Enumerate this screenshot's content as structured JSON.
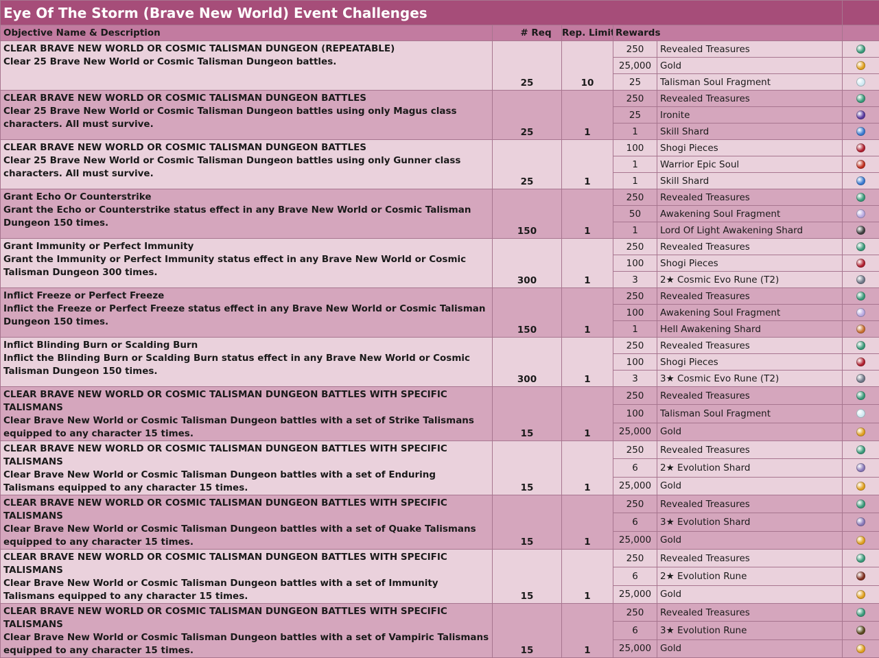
{
  "title": "Eye Of The Storm (Brave New World) Event Challenges",
  "headers": {
    "objective": "Objective Name & Description",
    "req": "# Req",
    "limit": "Rep. Limit",
    "rewards": "Rewards"
  },
  "colors": {
    "title_bg": "#a64d79",
    "header_bg": "#c27ba0",
    "row_light": "#ead1dc",
    "row_dark": "#d5a6bd"
  },
  "challenges": [
    {
      "name": "CLEAR BRAVE NEW WORLD OR COSMIC TALISMAN DUNGEON (REPEATABLE)",
      "desc": "Clear 25 Brave New World or Cosmic Talisman Dungeon battles.",
      "req": "25",
      "limit": "10",
      "rewards": [
        {
          "qty": "250",
          "name": "Revealed Treasures",
          "icon": "revealed-treasures-icon",
          "color": "#3a9a7a"
        },
        {
          "qty": "25,000",
          "name": "Gold",
          "icon": "gold-icon",
          "color": "#e0a020"
        },
        {
          "qty": "25",
          "name": "Talisman Soul Fragment",
          "icon": "talisman-soul-fragment-icon",
          "color": "#cfe8f2"
        }
      ]
    },
    {
      "name": "CLEAR BRAVE NEW WORLD OR COSMIC TALISMAN DUNGEON BATTLES",
      "desc": "Clear 25 Brave New World or Cosmic Talisman Dungeon battles using only Magus class characters. All must survive.",
      "req": "25",
      "limit": "1",
      "rewards": [
        {
          "qty": "250",
          "name": "Revealed Treasures",
          "icon": "revealed-treasures-icon",
          "color": "#3a9a7a"
        },
        {
          "qty": "25",
          "name": "Ironite",
          "icon": "ironite-icon",
          "color": "#5a3aa0"
        },
        {
          "qty": "1",
          "name": "Skill Shard",
          "icon": "skill-shard-icon",
          "color": "#3a7ad0"
        }
      ]
    },
    {
      "name": "CLEAR BRAVE NEW WORLD OR COSMIC TALISMAN DUNGEON BATTLES",
      "desc": "Clear 25 Brave New World or Cosmic Talisman Dungeon battles using only Gunner class characters. All must survive.",
      "req": "25",
      "limit": "1",
      "rewards": [
        {
          "qty": "100",
          "name": "Shogi Pieces",
          "icon": "shogi-pieces-icon",
          "color": "#b02030"
        },
        {
          "qty": "1",
          "name": "Warrior Epic Soul",
          "icon": "warrior-epic-soul-icon",
          "color": "#c03020"
        },
        {
          "qty": "1",
          "name": "Skill Shard",
          "icon": "skill-shard-icon",
          "color": "#3a7ad0"
        }
      ]
    },
    {
      "name": "Grant Echo Or Counterstrike",
      "desc": "Grant the Echo or Counterstrike status effect in any Brave New World or Cosmic Talisman Dungeon 150 times.",
      "req": "150",
      "limit": "1",
      "rewards": [
        {
          "qty": "250",
          "name": "Revealed Treasures",
          "icon": "revealed-treasures-icon",
          "color": "#3a9a7a"
        },
        {
          "qty": "50",
          "name": "Awakening Soul Fragment",
          "icon": "awakening-soul-fragment-icon",
          "color": "#b8a8e0"
        },
        {
          "qty": "1",
          "name": "Lord Of Light Awakening Shard",
          "icon": "lord-of-light-awakening-shard-icon",
          "color": "#404040"
        }
      ]
    },
    {
      "name": "Grant Immunity or Perfect Immunity",
      "desc": "Grant the Immunity or Perfect Immunity status effect in any Brave New World or Cosmic Talisman Dungeon 300 times.",
      "req": "300",
      "limit": "1",
      "rewards": [
        {
          "qty": "250",
          "name": "Revealed Treasures",
          "icon": "revealed-treasures-icon",
          "color": "#3a9a7a"
        },
        {
          "qty": "100",
          "name": "Shogi Pieces",
          "icon": "shogi-pieces-icon",
          "color": "#b02030"
        },
        {
          "qty": "3",
          "name": "2★ Cosmic Evo Rune (T2)",
          "icon": "cosmic-evo-rune-icon",
          "color": "#707888"
        }
      ]
    },
    {
      "name": "Inflict Freeze or Perfect Freeze",
      "desc": "Inflict the Freeze or Perfect Freeze status effect in any Brave New World or Cosmic Talisman Dungeon 150 times.",
      "req": "150",
      "limit": "1",
      "rewards": [
        {
          "qty": "250",
          "name": "Revealed Treasures",
          "icon": "revealed-treasures-icon",
          "color": "#3a9a7a"
        },
        {
          "qty": "100",
          "name": "Awakening Soul Fragment",
          "icon": "awakening-soul-fragment-icon",
          "color": "#b8a8e0"
        },
        {
          "qty": "1",
          "name": "Hell Awakening Shard",
          "icon": "hell-awakening-shard-icon",
          "color": "#c87030"
        }
      ]
    },
    {
      "name": "Inflict Blinding Burn or Scalding Burn",
      "desc": "Inflict the Blinding Burn or Scalding Burn status effect in any Brave New World or Cosmic Talisman Dungeon 150 times.",
      "req": "300",
      "limit": "1",
      "rewards": [
        {
          "qty": "250",
          "name": "Revealed Treasures",
          "icon": "revealed-treasures-icon",
          "color": "#3a9a7a"
        },
        {
          "qty": "100",
          "name": "Shogi Pieces",
          "icon": "shogi-pieces-icon",
          "color": "#b02030"
        },
        {
          "qty": "3",
          "name": "3★ Cosmic Evo Rune (T2)",
          "icon": "cosmic-evo-rune-icon",
          "color": "#707888"
        }
      ]
    },
    {
      "name": "CLEAR BRAVE NEW WORLD OR COSMIC TALISMAN DUNGEON BATTLES WITH SPECIFIC TALISMANS",
      "desc": "Clear Brave New World or Cosmic Talisman Dungeon battles with a set of Strike Talismans equipped to any character 15 times.",
      "req": "15",
      "limit": "1",
      "rewards": [
        {
          "qty": "250",
          "name": "Revealed Treasures",
          "icon": "revealed-treasures-icon",
          "color": "#3a9a7a"
        },
        {
          "qty": "100",
          "name": "Talisman Soul Fragment",
          "icon": "talisman-soul-fragment-icon",
          "color": "#cfe8f2"
        },
        {
          "qty": "25,000",
          "name": "Gold",
          "icon": "gold-icon",
          "color": "#e0a020"
        }
      ]
    },
    {
      "name": "CLEAR BRAVE NEW WORLD OR COSMIC TALISMAN DUNGEON BATTLES WITH SPECIFIC TALISMANS",
      "desc": "Clear Brave New World or Cosmic Talisman Dungeon battles with a set of Enduring Talismans equipped to any character 15 times.",
      "req": "15",
      "limit": "1",
      "rewards": [
        {
          "qty": "250",
          "name": "Revealed Treasures",
          "icon": "revealed-treasures-icon",
          "color": "#3a9a7a"
        },
        {
          "qty": "6",
          "name": "2★ Evolution Shard",
          "icon": "evolution-shard-icon",
          "color": "#8878b8"
        },
        {
          "qty": "25,000",
          "name": "Gold",
          "icon": "gold-icon",
          "color": "#e0a020"
        }
      ]
    },
    {
      "name": "CLEAR BRAVE NEW WORLD OR COSMIC TALISMAN DUNGEON BATTLES WITH SPECIFIC TALISMANS",
      "desc": "Clear Brave New World or Cosmic Talisman Dungeon battles with a set of Quake Talismans equipped to any character 15 times.",
      "req": "15",
      "limit": "1",
      "rewards": [
        {
          "qty": "250",
          "name": "Revealed Treasures",
          "icon": "revealed-treasures-icon",
          "color": "#3a9a7a"
        },
        {
          "qty": "6",
          "name": "3★ Evolution Shard",
          "icon": "evolution-shard-icon",
          "color": "#8878b8"
        },
        {
          "qty": "25,000",
          "name": "Gold",
          "icon": "gold-icon",
          "color": "#e0a020"
        }
      ]
    },
    {
      "name": "CLEAR BRAVE NEW WORLD OR COSMIC TALISMAN DUNGEON BATTLES WITH SPECIFIC TALISMANS",
      "desc": "Clear Brave New World or Cosmic Talisman Dungeon battles with a set of Immunity Talismans equipped to any character 15 times.",
      "req": "15",
      "limit": "1",
      "rewards": [
        {
          "qty": "250",
          "name": "Revealed Treasures",
          "icon": "revealed-treasures-icon",
          "color": "#3a9a7a"
        },
        {
          "qty": "6",
          "name": "2★ Evolution Rune",
          "icon": "evolution-rune-icon",
          "color": "#803020"
        },
        {
          "qty": "25,000",
          "name": "Gold",
          "icon": "gold-icon",
          "color": "#e0a020"
        }
      ]
    },
    {
      "name": "CLEAR BRAVE NEW WORLD OR COSMIC TALISMAN DUNGEON BATTLES WITH SPECIFIC TALISMANS",
      "desc": "Clear Brave New World or Cosmic Talisman Dungeon battles with a set of Vampiric Talismans equipped to any character 15 times.",
      "req": "15",
      "limit": "1",
      "rewards": [
        {
          "qty": "250",
          "name": "Revealed Treasures",
          "icon": "revealed-treasures-icon",
          "color": "#3a9a7a"
        },
        {
          "qty": "6",
          "name": "3★ Evolution Rune",
          "icon": "evolution-rune-icon",
          "color": "#5a4a20"
        },
        {
          "qty": "25,000",
          "name": "Gold",
          "icon": "gold-icon",
          "color": "#e0a020"
        }
      ]
    }
  ]
}
